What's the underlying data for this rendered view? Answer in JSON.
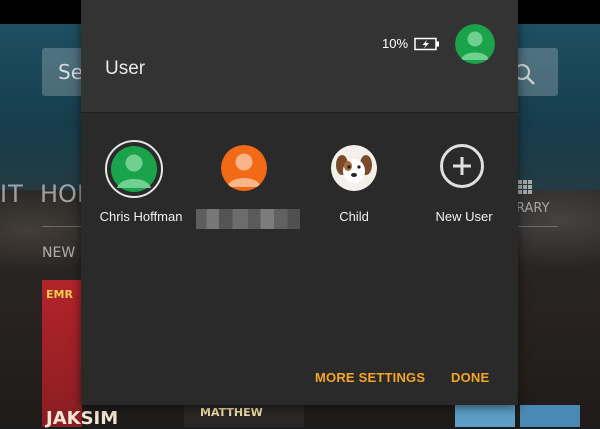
{
  "background": {
    "search_placeholder": "Se",
    "nav_left_fragment": "IT",
    "nav_home_fragment": "HOI",
    "nav_library_fragment": "RARY",
    "section_new": "NEW",
    "book_left_title_fragment": "EMR",
    "book_left_bottom_fragment": "JAKSIM",
    "book_mid_title_fragment": "MATTHEW"
  },
  "status": {
    "battery_percent": "10%",
    "battery_icon": "battery-charging-icon"
  },
  "panel": {
    "title": "User"
  },
  "users": [
    {
      "name": "Chris Hoffman",
      "avatar_color": "#1aa34a",
      "selected": true
    },
    {
      "name": "",
      "avatar_color": "#f26a16",
      "selected": false,
      "name_obscured": true
    },
    {
      "name": "Child",
      "avatar": "puppy-photo",
      "selected": false
    },
    {
      "name": "New User",
      "icon": "plus-circle-icon",
      "selected": false
    }
  ],
  "actions": {
    "more_settings": "MORE SETTINGS",
    "done": "DONE"
  },
  "colors": {
    "accent": "#f5a623",
    "panel_bg": "#2a2a2a",
    "header_bg": "#333333",
    "active_user_green": "#1aa34a"
  }
}
